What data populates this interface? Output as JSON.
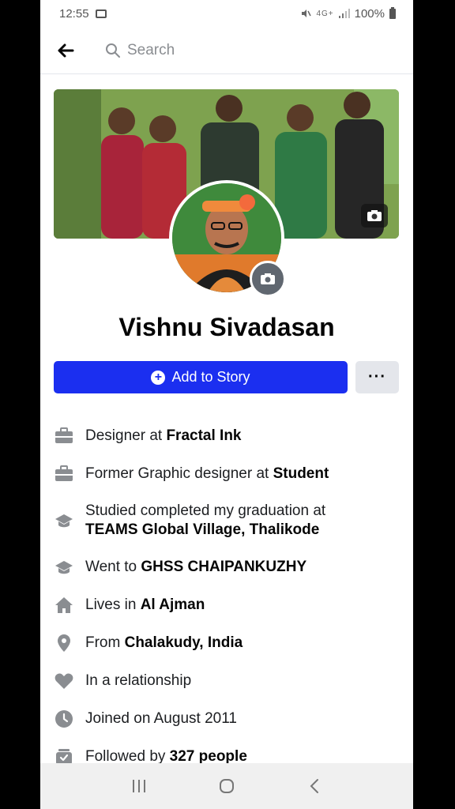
{
  "status_bar": {
    "time": "12:55",
    "network": "4G+",
    "battery": "100%"
  },
  "header": {
    "search_placeholder": "Search"
  },
  "profile": {
    "name": "Vishnu Sivadasan"
  },
  "actions": {
    "add_story_label": "Add to Story",
    "more_label": "···"
  },
  "details": [
    {
      "icon": "briefcase-icon",
      "prefix": "Designer at ",
      "bold": "Fractal Ink",
      "suffix": ""
    },
    {
      "icon": "briefcase-icon",
      "prefix": "Former Graphic designer at ",
      "bold": "Student",
      "suffix": ""
    },
    {
      "icon": "graduation-cap-icon",
      "prefix": "Studied completed my graduation at",
      "bold": "TEAMS Global Village, Thalikode",
      "suffix": ""
    },
    {
      "icon": "graduation-cap-icon",
      "prefix": "Went to ",
      "bold": "GHSS CHAIPANKUZHY",
      "suffix": ""
    },
    {
      "icon": "home-icon",
      "prefix": "Lives in ",
      "bold": "Al Ajman",
      "suffix": ""
    },
    {
      "icon": "location-pin-icon",
      "prefix": "From ",
      "bold": "Chalakudy, India",
      "suffix": ""
    },
    {
      "icon": "heart-icon",
      "prefix": "In a relationship",
      "bold": "",
      "suffix": ""
    },
    {
      "icon": "clock-icon",
      "prefix": "Joined on August 2011",
      "bold": "",
      "suffix": ""
    },
    {
      "icon": "followers-icon",
      "prefix": "Followed by ",
      "bold": "327 people",
      "suffix": ""
    }
  ],
  "colors": {
    "primary_button": "#1b2ff0",
    "icon_gray": "#8a8d91"
  }
}
